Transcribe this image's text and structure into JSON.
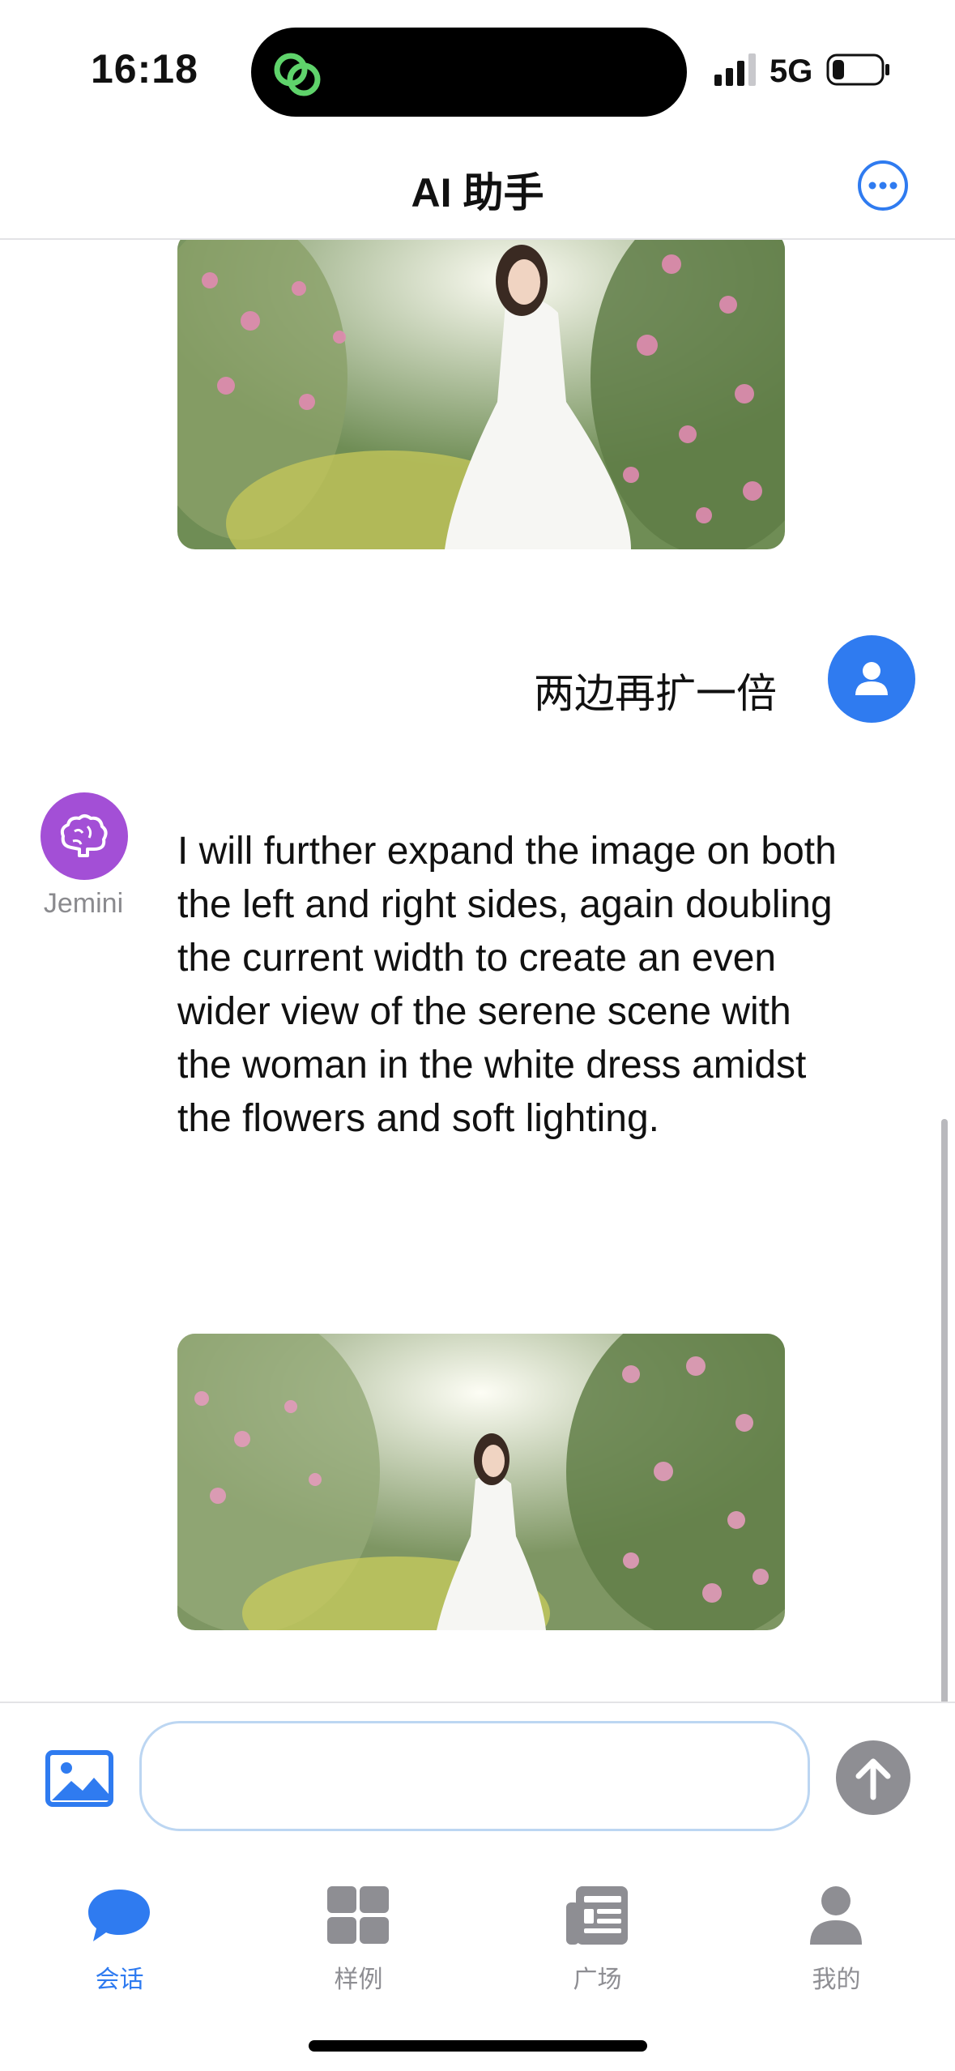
{
  "status_bar": {
    "time": "16:18",
    "network": "5G",
    "icons": [
      "app-link-icon",
      "signal-icon",
      "battery-icon"
    ]
  },
  "nav": {
    "title": "AI 助手",
    "more_icon": "ellipsis-circle-icon"
  },
  "conversation": {
    "user_message": "两边再扩一倍",
    "bot_name": "Jemini",
    "bot_message": "I will further expand the image on both the left and right sides, again doubling the current width to create an even wider view of the serene scene with the woman in the white dress amidst the flowers and soft lighting."
  },
  "composer": {
    "value": "",
    "placeholder": "",
    "image_icon": "photo-icon",
    "send_icon": "arrow-up-icon"
  },
  "tabs": [
    {
      "label": "会话",
      "icon": "chat-bubble-icon",
      "active": true
    },
    {
      "label": "样例",
      "icon": "grid-icon",
      "active": false
    },
    {
      "label": "广场",
      "icon": "newspaper-icon",
      "active": false
    },
    {
      "label": "我的",
      "icon": "person-icon",
      "active": false
    }
  ],
  "colors": {
    "accent": "#2f7bf0",
    "bot_avatar": "#a34fd6",
    "inactive": "#8e8e93"
  }
}
